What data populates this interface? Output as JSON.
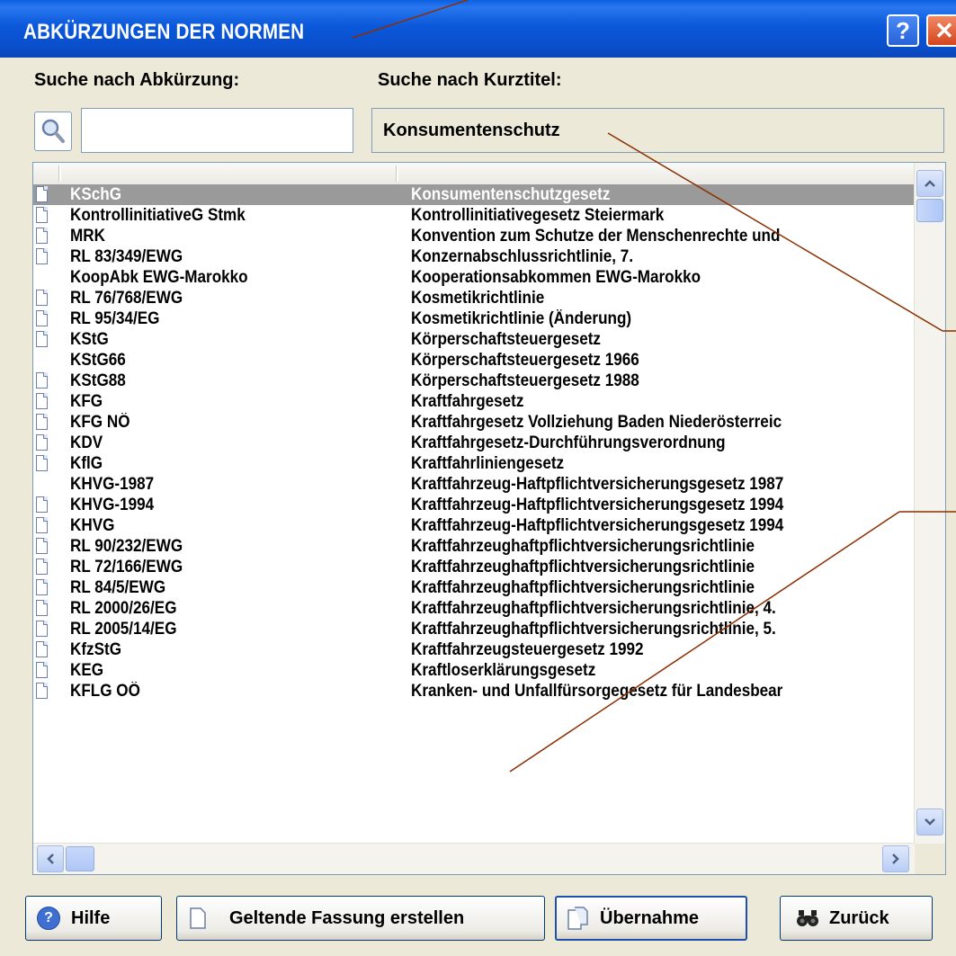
{
  "window": {
    "title": "ABKÜRZUNGEN DER NORMEN",
    "help_symbol": "?",
    "close_symbol": "✕"
  },
  "search": {
    "abk_label": "Suche nach Abkürzung:",
    "abk_value": "",
    "kurz_label": "Suche nach Kurztitel:",
    "kurz_value": "Konsumentenschutz"
  },
  "list": {
    "rows": [
      {
        "abk": "KSchG",
        "title": "Konsumentenschutzgesetz",
        "icon": true,
        "selected": true
      },
      {
        "abk": "KontrollinitiativeG Stmk",
        "title": "Kontrollinitiativegesetz Steiermark",
        "icon": true
      },
      {
        "abk": "MRK",
        "title": "Konvention zum Schutze der Menschenrechte und",
        "icon": true
      },
      {
        "abk": "RL 83/349/EWG",
        "title": "Konzernabschlussrichtlinie, 7.",
        "icon": true
      },
      {
        "abk": "KoopAbk EWG-Marokko",
        "title": "Kooperationsabkommen EWG-Marokko",
        "icon": false
      },
      {
        "abk": "RL 76/768/EWG",
        "title": "Kosmetikrichtlinie",
        "icon": true
      },
      {
        "abk": "RL 95/34/EG",
        "title": "Kosmetikrichtlinie (Änderung)",
        "icon": true
      },
      {
        "abk": "KStG",
        "title": "Körperschaftsteuergesetz",
        "icon": true
      },
      {
        "abk": "KStG66",
        "title": "Körperschaftsteuergesetz 1966",
        "icon": false
      },
      {
        "abk": "KStG88",
        "title": "Körperschaftsteuergesetz 1988",
        "icon": true
      },
      {
        "abk": "KFG",
        "title": "Kraftfahrgesetz",
        "icon": true
      },
      {
        "abk": "KFG NÖ",
        "title": "Kraftfahrgesetz Vollziehung Baden Niederösterreic",
        "icon": true
      },
      {
        "abk": "KDV",
        "title": "Kraftfahrgesetz-Durchführungsverordnung",
        "icon": true
      },
      {
        "abk": "KflG",
        "title": "Kraftfahrliniengesetz",
        "icon": true
      },
      {
        "abk": "KHVG-1987",
        "title": "Kraftfahrzeug-Haftpflichtversicherungsgesetz 1987",
        "icon": false
      },
      {
        "abk": "KHVG-1994",
        "title": "Kraftfahrzeug-Haftpflichtversicherungsgesetz 1994",
        "icon": true
      },
      {
        "abk": "KHVG",
        "title": "Kraftfahrzeug-Haftpflichtversicherungsgesetz 1994",
        "icon": true
      },
      {
        "abk": "RL 90/232/EWG",
        "title": "Kraftfahrzeughaftpflichtversicherungsrichtlinie",
        "icon": true
      },
      {
        "abk": "RL 72/166/EWG",
        "title": "Kraftfahrzeughaftpflichtversicherungsrichtlinie",
        "icon": true
      },
      {
        "abk": "RL 84/5/EWG",
        "title": "Kraftfahrzeughaftpflichtversicherungsrichtlinie",
        "icon": true
      },
      {
        "abk": "RL 2000/26/EG",
        "title": "Kraftfahrzeughaftpflichtversicherungsrichtlinie, 4.",
        "icon": true
      },
      {
        "abk": "RL 2005/14/EG",
        "title": "Kraftfahrzeughaftpflichtversicherungsrichtlinie, 5.",
        "icon": true
      },
      {
        "abk": "KfzStG",
        "title": "Kraftfahrzeugsteuergesetz 1992",
        "icon": true
      },
      {
        "abk": "KEG",
        "title": "Kraftloserklärungsgesetz",
        "icon": true
      },
      {
        "abk": "KFLG OÖ",
        "title": "Kranken- und Unfallfürsorgegesetz für Landesbear",
        "icon": true
      }
    ]
  },
  "buttons": {
    "help": "Hilfe",
    "geltende": "Geltende Fassung erstellen",
    "uebernahme": "Übernahme",
    "zurueck": "Zurück"
  },
  "colors": {
    "titlebar": "#0a52d6",
    "selection": "#9a9a9a",
    "annotation_line": "#8b2f00"
  }
}
